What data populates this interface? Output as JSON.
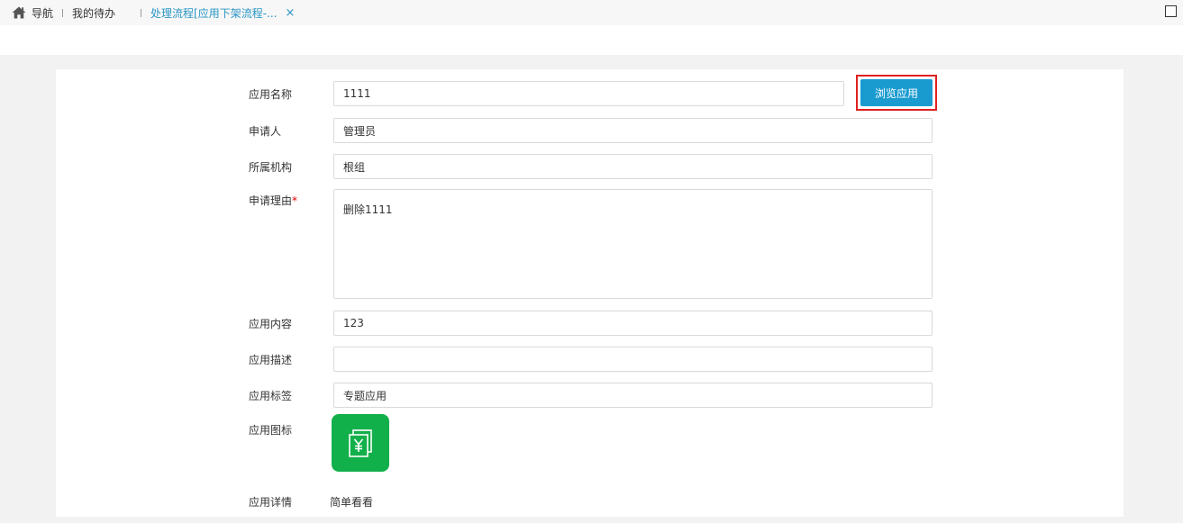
{
  "tabs": {
    "nav_label": "导航",
    "todo_label": "我的待办",
    "active_label": "处理流程[应用下架流程-...",
    "close_glyph": "×"
  },
  "form": {
    "app_name": {
      "label": "应用名称",
      "value": "1111"
    },
    "browse_button": "浏览应用",
    "applicant": {
      "label": "申请人",
      "value": "管理员"
    },
    "organization": {
      "label": "所属机构",
      "value": "根组"
    },
    "reason": {
      "label": "申请理由",
      "required_mark": "*",
      "value": "删除1111"
    },
    "content": {
      "label": "应用内容",
      "value": "123"
    },
    "description": {
      "label": "应用描述",
      "value": ""
    },
    "tags": {
      "label": "应用标签",
      "value": "专题应用"
    },
    "icon": {
      "label": "应用图标",
      "icon_name": "document-yen-icon",
      "color": "#12b04a"
    },
    "details": {
      "label": "应用详情",
      "value": "简单看看"
    }
  },
  "colors": {
    "accent": "#1a9bd0",
    "active_tab": "#2a96c5",
    "highlight_border": "#e02020",
    "required": "#e00000"
  }
}
